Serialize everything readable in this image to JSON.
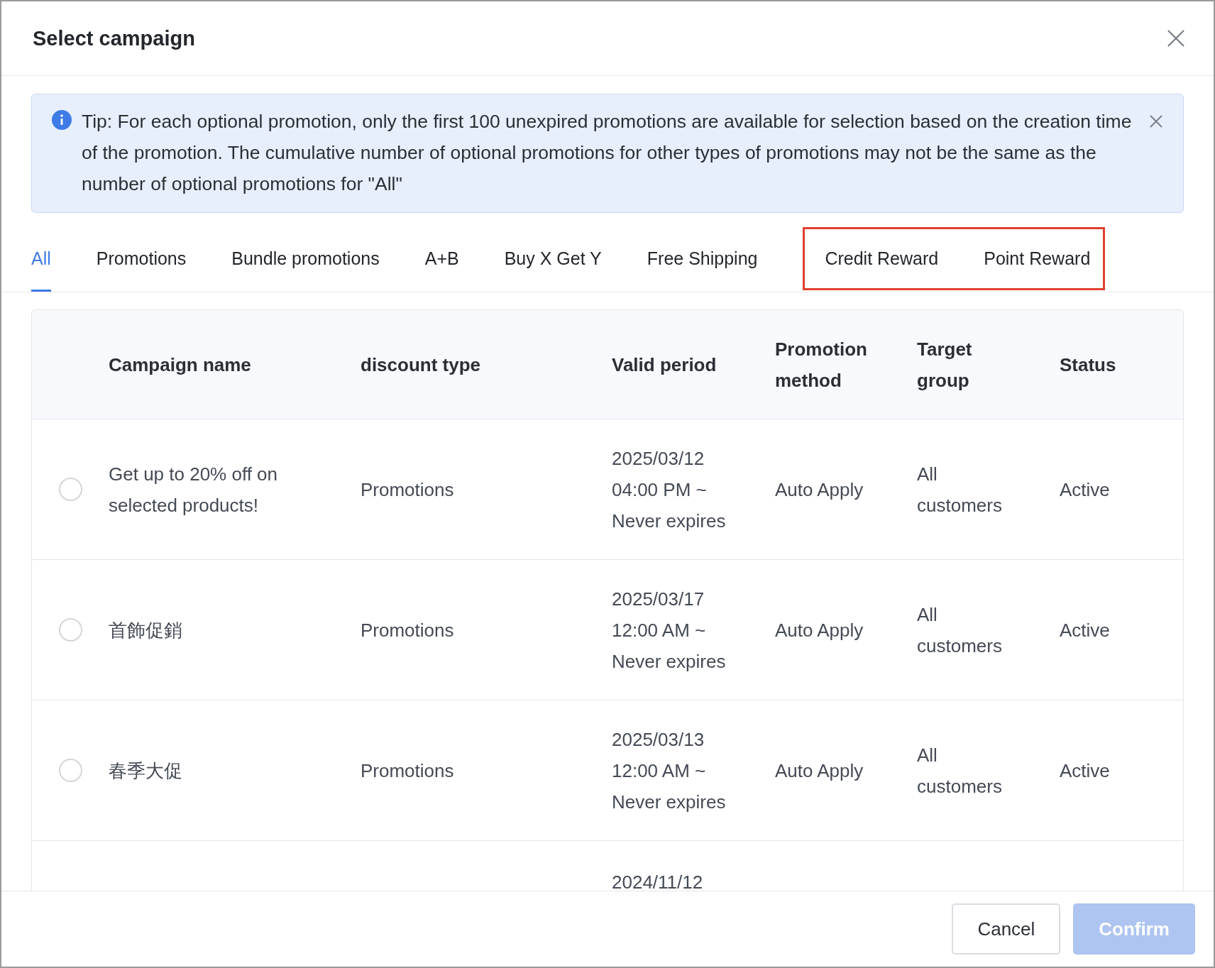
{
  "dialog": {
    "title": "Select campaign"
  },
  "tip": {
    "text": "Tip: For each optional promotion, only the first 100 unexpired promotions are available for selection based on the creation time of the promotion. The cumulative number of optional promotions for other types of promotions may not be the same as the number of optional promotions for \"All\""
  },
  "tabs": [
    {
      "label": "All",
      "selected": true,
      "highlighted": false
    },
    {
      "label": "Promotions",
      "selected": false,
      "highlighted": false
    },
    {
      "label": "Bundle promotions",
      "selected": false,
      "highlighted": false
    },
    {
      "label": "A+B",
      "selected": false,
      "highlighted": false
    },
    {
      "label": "Buy X Get Y",
      "selected": false,
      "highlighted": false
    },
    {
      "label": "Free Shipping",
      "selected": false,
      "highlighted": false
    },
    {
      "label": "Credit Reward",
      "selected": false,
      "highlighted": true
    },
    {
      "label": "Point Reward",
      "selected": false,
      "highlighted": true
    }
  ],
  "table": {
    "columns": [
      "Campaign name",
      "discount type",
      "Valid period",
      "Promotion method",
      "Target group",
      "Status"
    ],
    "rows": [
      {
        "selected": false,
        "cells": [
          "Get up to 20% off on selected products!",
          "Promotions",
          "2025/03/12 04:00 PM ~ Never expires",
          "Auto Apply",
          "All customers",
          "Active"
        ]
      },
      {
        "selected": false,
        "cells": [
          "首飾促銷",
          "Promotions",
          "2025/03/17 12:00 AM ~ Never expires",
          "Auto Apply",
          "All customers",
          "Active"
        ]
      },
      {
        "selected": false,
        "cells": [
          "春季大促",
          "Promotions",
          "2025/03/13 12:00 AM ~ Never expires",
          "Auto Apply",
          "All customers",
          "Active"
        ]
      },
      {
        "partial": true,
        "cells": [
          "",
          "",
          "2024/11/12",
          "",
          "",
          ""
        ]
      }
    ]
  },
  "footer": {
    "cancel": "Cancel",
    "confirm": "Confirm",
    "confirm_disabled": true
  }
}
